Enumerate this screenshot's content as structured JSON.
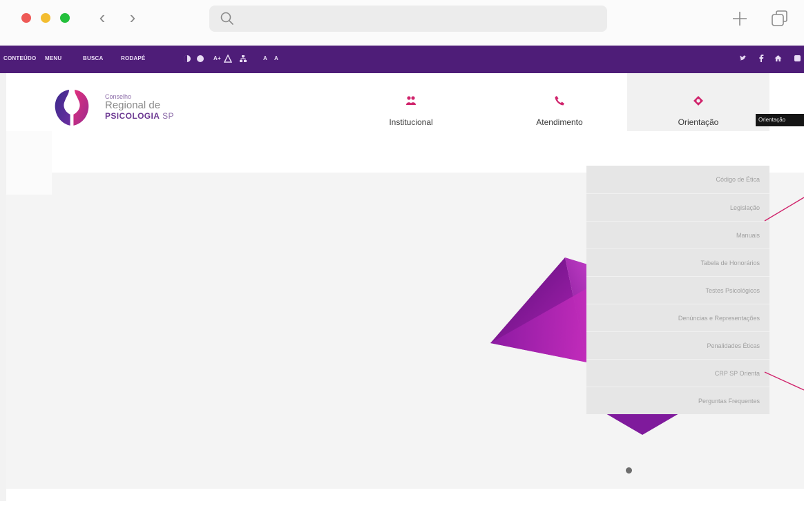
{
  "browser": {
    "back_label": "‹",
    "forward_label": "›",
    "url_value": "",
    "url_placeholder": ""
  },
  "accessibility_bar": {
    "links": [
      "CONTEÚDO",
      "MENU",
      "BUSCA",
      "RODAPÉ"
    ],
    "font_controls": [
      "A+",
      "A",
      "A"
    ],
    "icons": [
      "contrast-icon",
      "contrast-dark-icon",
      "accessibility-icon",
      "sitemap-icon"
    ],
    "social_icons": [
      "twitter-icon",
      "facebook-icon",
      "home-icon",
      "extra-icon"
    ],
    "background": "#4e1d78"
  },
  "logo": {
    "line1": "Conselho",
    "line2": "Regional de",
    "line3": "PSICOLOGIA",
    "line3_suffix": "SP"
  },
  "nav": {
    "items": [
      {
        "label": "Institucional",
        "icon": "people-icon"
      },
      {
        "label": "Atendimento",
        "icon": "phone-icon"
      },
      {
        "label": "Orientação",
        "icon": "target-icon"
      }
    ],
    "tooltip": "Orientação"
  },
  "dropdown": {
    "items": [
      "Código de Ética",
      "Legislação",
      "Manuais",
      "Tabela de Honorários",
      "Testes Psicológicos",
      "Denúncias e Representações",
      "Penalidades Éticas",
      "CRP SP Orienta",
      "Perguntas Frequentes"
    ]
  },
  "colors": {
    "accent": "#4e1d78",
    "brand_pink": "#d0246c",
    "menu_bg": "#e6e6e6"
  }
}
